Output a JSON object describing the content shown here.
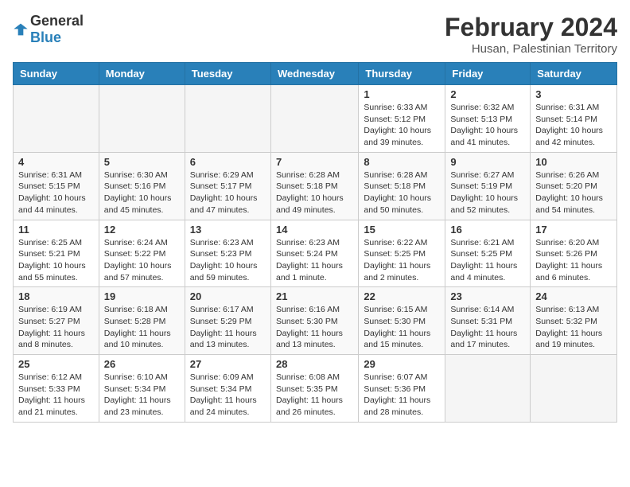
{
  "logo": {
    "general": "General",
    "blue": "Blue"
  },
  "title": {
    "month_year": "February 2024",
    "location": "Husan, Palestinian Territory"
  },
  "weekdays": [
    "Sunday",
    "Monday",
    "Tuesday",
    "Wednesday",
    "Thursday",
    "Friday",
    "Saturday"
  ],
  "weeks": [
    [
      {
        "day": "",
        "info": ""
      },
      {
        "day": "",
        "info": ""
      },
      {
        "day": "",
        "info": ""
      },
      {
        "day": "",
        "info": ""
      },
      {
        "day": "1",
        "info": "Sunrise: 6:33 AM\nSunset: 5:12 PM\nDaylight: 10 hours and 39 minutes."
      },
      {
        "day": "2",
        "info": "Sunrise: 6:32 AM\nSunset: 5:13 PM\nDaylight: 10 hours and 41 minutes."
      },
      {
        "day": "3",
        "info": "Sunrise: 6:31 AM\nSunset: 5:14 PM\nDaylight: 10 hours and 42 minutes."
      }
    ],
    [
      {
        "day": "4",
        "info": "Sunrise: 6:31 AM\nSunset: 5:15 PM\nDaylight: 10 hours and 44 minutes."
      },
      {
        "day": "5",
        "info": "Sunrise: 6:30 AM\nSunset: 5:16 PM\nDaylight: 10 hours and 45 minutes."
      },
      {
        "day": "6",
        "info": "Sunrise: 6:29 AM\nSunset: 5:17 PM\nDaylight: 10 hours and 47 minutes."
      },
      {
        "day": "7",
        "info": "Sunrise: 6:28 AM\nSunset: 5:18 PM\nDaylight: 10 hours and 49 minutes."
      },
      {
        "day": "8",
        "info": "Sunrise: 6:28 AM\nSunset: 5:18 PM\nDaylight: 10 hours and 50 minutes."
      },
      {
        "day": "9",
        "info": "Sunrise: 6:27 AM\nSunset: 5:19 PM\nDaylight: 10 hours and 52 minutes."
      },
      {
        "day": "10",
        "info": "Sunrise: 6:26 AM\nSunset: 5:20 PM\nDaylight: 10 hours and 54 minutes."
      }
    ],
    [
      {
        "day": "11",
        "info": "Sunrise: 6:25 AM\nSunset: 5:21 PM\nDaylight: 10 hours and 55 minutes."
      },
      {
        "day": "12",
        "info": "Sunrise: 6:24 AM\nSunset: 5:22 PM\nDaylight: 10 hours and 57 minutes."
      },
      {
        "day": "13",
        "info": "Sunrise: 6:23 AM\nSunset: 5:23 PM\nDaylight: 10 hours and 59 minutes."
      },
      {
        "day": "14",
        "info": "Sunrise: 6:23 AM\nSunset: 5:24 PM\nDaylight: 11 hours and 1 minute."
      },
      {
        "day": "15",
        "info": "Sunrise: 6:22 AM\nSunset: 5:25 PM\nDaylight: 11 hours and 2 minutes."
      },
      {
        "day": "16",
        "info": "Sunrise: 6:21 AM\nSunset: 5:25 PM\nDaylight: 11 hours and 4 minutes."
      },
      {
        "day": "17",
        "info": "Sunrise: 6:20 AM\nSunset: 5:26 PM\nDaylight: 11 hours and 6 minutes."
      }
    ],
    [
      {
        "day": "18",
        "info": "Sunrise: 6:19 AM\nSunset: 5:27 PM\nDaylight: 11 hours and 8 minutes."
      },
      {
        "day": "19",
        "info": "Sunrise: 6:18 AM\nSunset: 5:28 PM\nDaylight: 11 hours and 10 minutes."
      },
      {
        "day": "20",
        "info": "Sunrise: 6:17 AM\nSunset: 5:29 PM\nDaylight: 11 hours and 13 minutes."
      },
      {
        "day": "21",
        "info": "Sunrise: 6:16 AM\nSunset: 5:30 PM\nDaylight: 11 hours and 13 minutes."
      },
      {
        "day": "22",
        "info": "Sunrise: 6:15 AM\nSunset: 5:30 PM\nDaylight: 11 hours and 15 minutes."
      },
      {
        "day": "23",
        "info": "Sunrise: 6:14 AM\nSunset: 5:31 PM\nDaylight: 11 hours and 17 minutes."
      },
      {
        "day": "24",
        "info": "Sunrise: 6:13 AM\nSunset: 5:32 PM\nDaylight: 11 hours and 19 minutes."
      }
    ],
    [
      {
        "day": "25",
        "info": "Sunrise: 6:12 AM\nSunset: 5:33 PM\nDaylight: 11 hours and 21 minutes."
      },
      {
        "day": "26",
        "info": "Sunrise: 6:10 AM\nSunset: 5:34 PM\nDaylight: 11 hours and 23 minutes."
      },
      {
        "day": "27",
        "info": "Sunrise: 6:09 AM\nSunset: 5:34 PM\nDaylight: 11 hours and 24 minutes."
      },
      {
        "day": "28",
        "info": "Sunrise: 6:08 AM\nSunset: 5:35 PM\nDaylight: 11 hours and 26 minutes."
      },
      {
        "day": "29",
        "info": "Sunrise: 6:07 AM\nSunset: 5:36 PM\nDaylight: 11 hours and 28 minutes."
      },
      {
        "day": "",
        "info": ""
      },
      {
        "day": "",
        "info": ""
      }
    ]
  ]
}
